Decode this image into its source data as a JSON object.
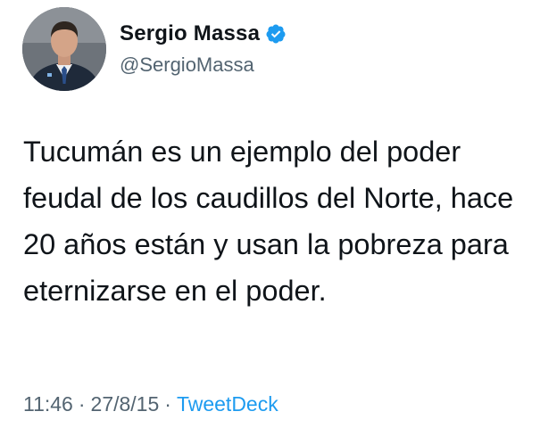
{
  "user": {
    "display_name": "Sergio Massa",
    "handle": "@SergioMassa",
    "verified": true,
    "verified_color": "#1d9bf0"
  },
  "tweet": {
    "text": "Tucumán es un ejemplo del poder feudal de los caudillos del Norte, hace 20 años están y usan la pobreza para eternizarse en el poder."
  },
  "meta": {
    "time": "11:46",
    "separator": "·",
    "date": "27/8/15",
    "source": "TweetDeck",
    "source_color": "#1d9bf0"
  }
}
